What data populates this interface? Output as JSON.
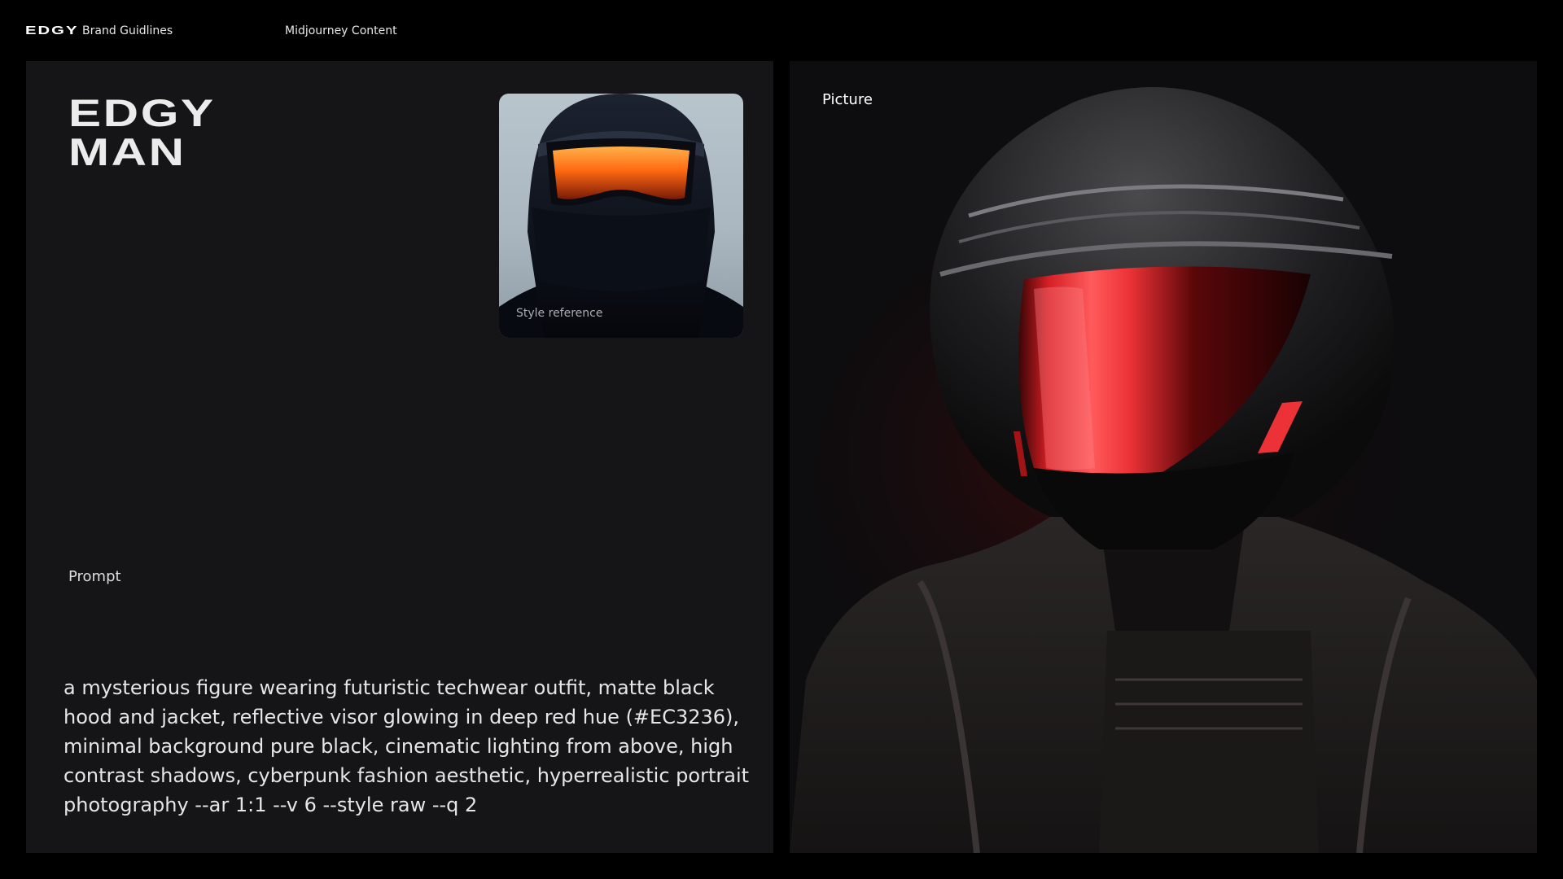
{
  "header": {
    "logo": "EDGY",
    "brand_label": "Brand Guidlines",
    "section_label": "Midjourney Content"
  },
  "left_panel": {
    "title_line1": "EDGY",
    "title_line2": "MAN",
    "style_reference_label": "Style reference",
    "prompt_label": "Prompt",
    "prompt_text": "a mysterious figure wearing futuristic techwear outfit, matte black hood and jacket, reflective visor glowing in deep red hue (#EC3236), minimal background pure black, cinematic lighting from above, high contrast shadows, cyberpunk fashion aesthetic, hyperrealistic portrait photography --ar 1:1 --v 6 --style raw --q 2"
  },
  "right_panel": {
    "picture_label": "Picture"
  },
  "colors": {
    "background": "#000000",
    "panel": "#151416",
    "visor_red": "#EC3236",
    "visor_orange": "#ff7a1a"
  },
  "icons": [
    "style-reference-image",
    "helmet-figure-image"
  ]
}
